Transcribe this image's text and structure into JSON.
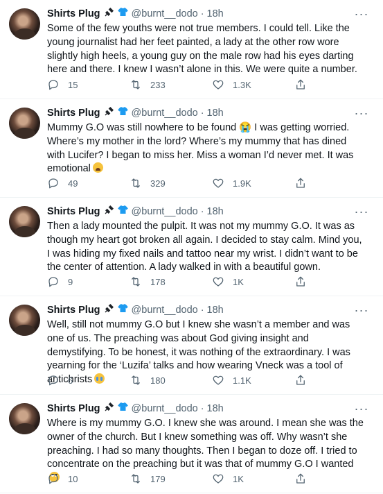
{
  "author": {
    "name": "Shirts Plug",
    "handle": "@burnt__dodo",
    "badges": [
      "plug-icon",
      "shirt-icon"
    ]
  },
  "separator": "·",
  "more_label": "···",
  "colors": {
    "text": "#0f1419",
    "secondary": "#536471",
    "shirt_badge": "#1d9bf0",
    "divider": "#eff3f4"
  },
  "tweets": [
    {
      "time": "18h",
      "text": "Some of the few youths were not true members. I could tell. Like the young journalist had her feet painted, a lady at the other row wore slightly high heels, a young guy on the male row had his eyes darting here and there. I knew I wasn’t alone in this. We were quite a number.",
      "emoji": "",
      "replies": "15",
      "retweets": "233",
      "likes": "1.3K"
    },
    {
      "time": "18h",
      "text": "Mummy G.O was still nowhere to be found 😭 I was getting worried. Where’s my mother in the lord? Where’s my mummy that has dined with Lucifer? I began to miss her. Miss a woman I’d never met. It was emotional",
      "emoji": "weary",
      "replies": "49",
      "retweets": "329",
      "likes": "1.9K"
    },
    {
      "time": "18h",
      "text": "Then a lady mounted the pulpit. It was not my mummy G.O. It was as though my heart got broken all again. I decided to stay calm. Mind you, I was hiding my fixed nails and tattoo near my wrist. I didn’t want to be the center of attention. A lady walked in with a beautiful gown.",
      "emoji": "",
      "replies": "9",
      "retweets": "178",
      "likes": "1K"
    },
    {
      "time": "18h",
      "text": "Well, still not mummy G.O but I knew she wasn’t a member and was one of us. The preaching was about God giving insight and demystifying. To be honest, it was nothing of the extraordinary. I was yearning for the ‘Luzifa’ talks and how wearing Vneck was a tool of antichrists",
      "emoji": "cry",
      "replies": "6",
      "retweets": "180",
      "likes": "1.1K"
    },
    {
      "time": "18h",
      "text": "Where is my mummy G.O. I knew she was around. I mean she was the owner of the church. But I knew something was off. Why wasn’t she preaching. I had so many thoughts. Then I began to doze off. I tried to concentrate on the preaching but it was that of mummy G.O I wanted",
      "emoji": "roll",
      "replies": "10",
      "retweets": "179",
      "likes": "1K"
    }
  ]
}
